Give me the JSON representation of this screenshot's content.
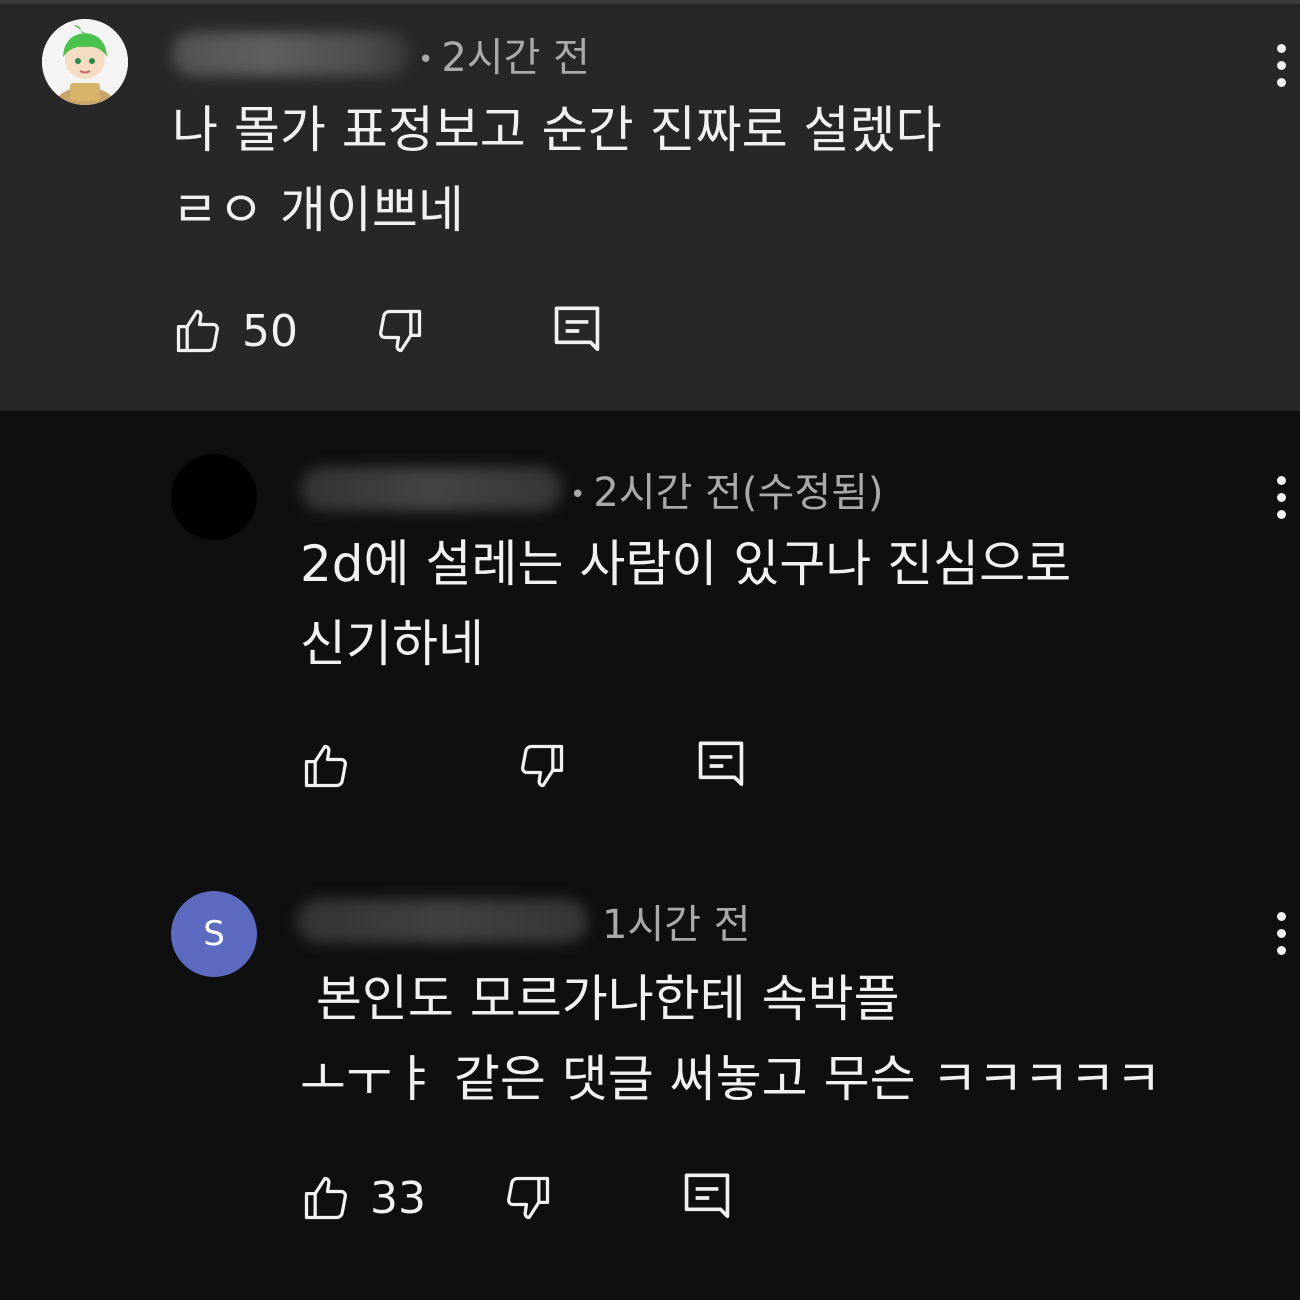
{
  "comments": [
    {
      "time": "2시간 전",
      "text": "나 몰가 표정보고 순간 진짜로 설렜다\nㄹㅇ 개이쁘네",
      "likes": "50"
    },
    {
      "time": "2시간 전(수정됨)",
      "text": "2d에 설레는 사람이 있구나 진심으로\n신기하네",
      "likes": ""
    },
    {
      "avatar_letter": "S",
      "avatar_color": "#5c6bc0",
      "time": "1시간 전",
      "mention": "@...",
      "text_after_mention": " 본인도 모르가나한테 속박플\nㅗㅜㅑ 같은 댓글 써놓고 무슨 ㅋㅋㅋㅋㅋ",
      "likes": "33"
    }
  ],
  "icons": {
    "like": "thumbs-up-icon",
    "dislike": "thumbs-down-icon",
    "reply": "reply-icon",
    "menu": "more-vert-icon"
  }
}
